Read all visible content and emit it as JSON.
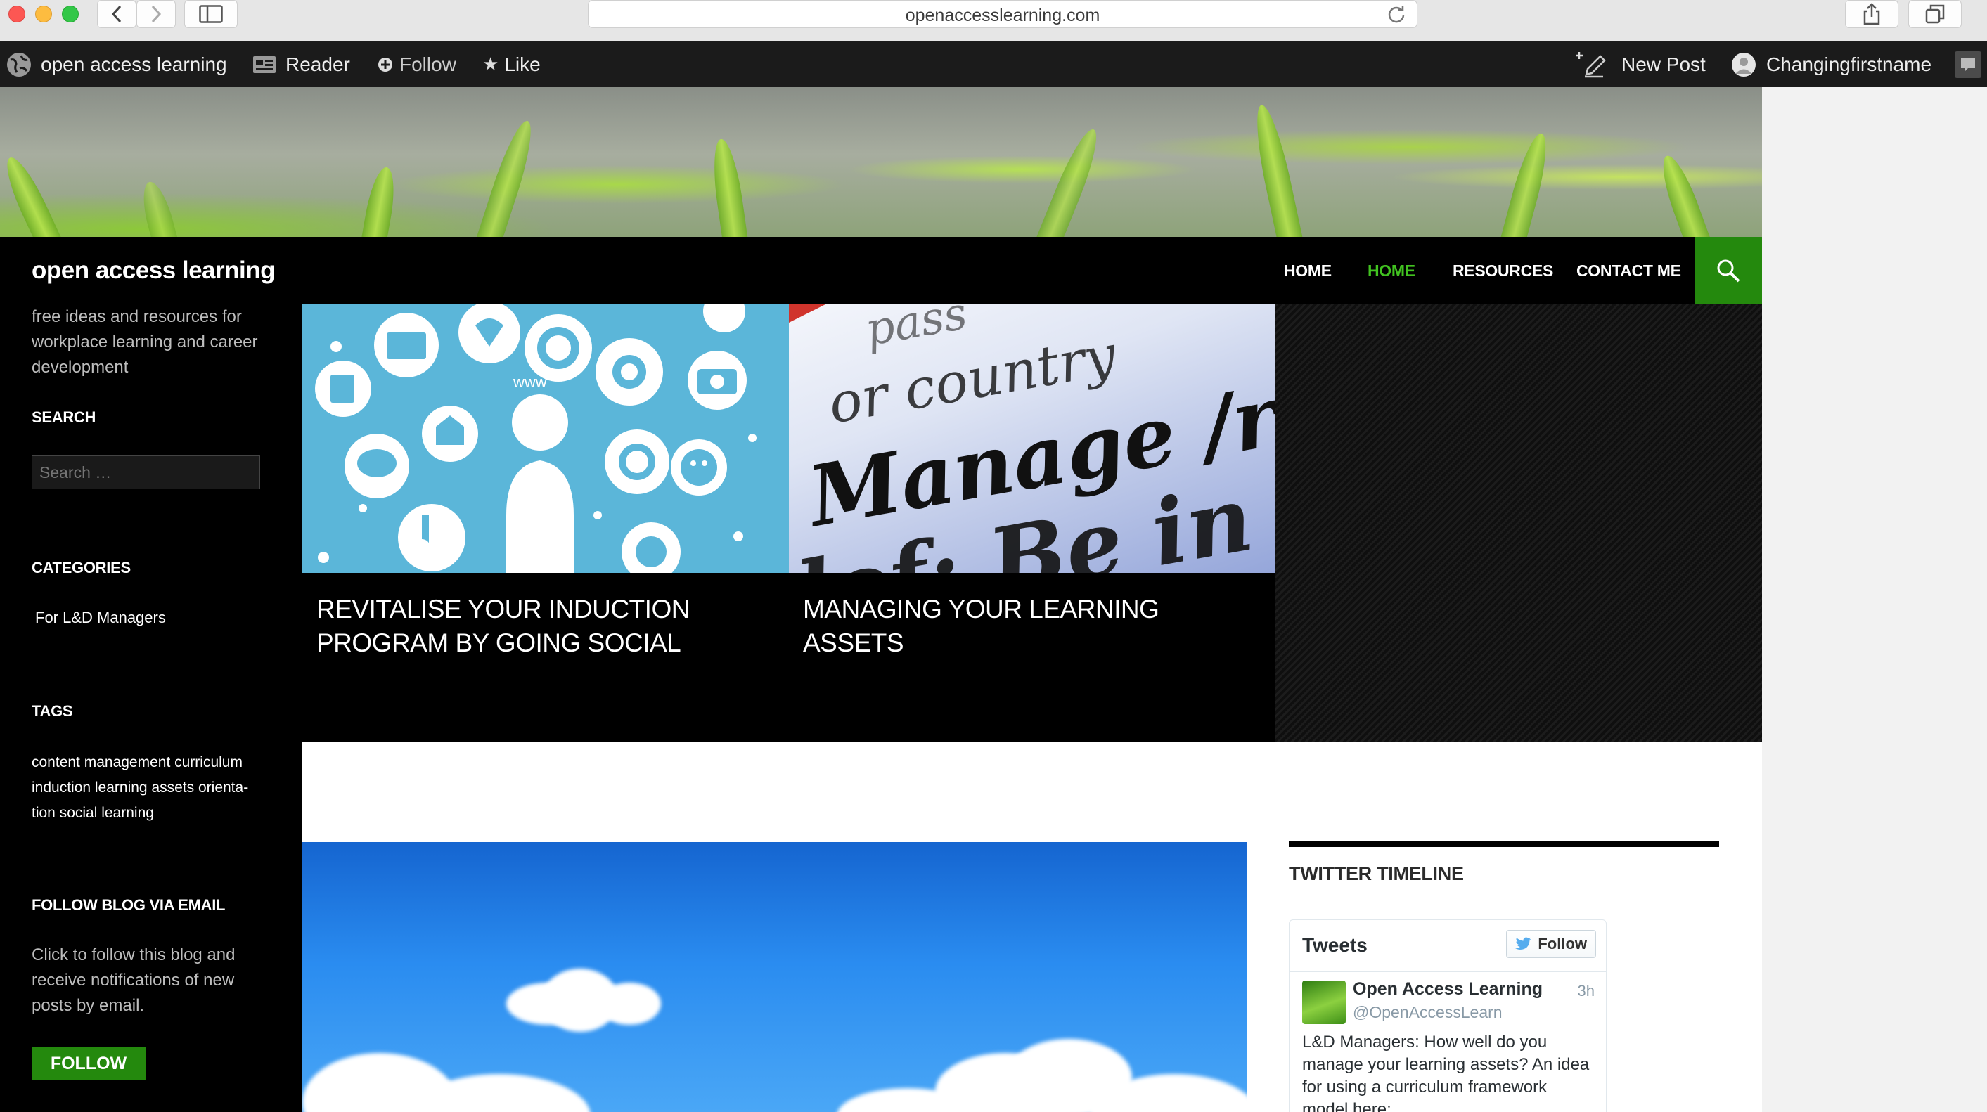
{
  "browser": {
    "url": "openaccesslearning.com"
  },
  "admin_bar": {
    "site_name": "open access learning",
    "reader": "Reader",
    "follow": "Follow",
    "like": "Like",
    "new_post": "New Post",
    "user_name": "Changingfirstname"
  },
  "site": {
    "title": "open access learning",
    "tagline": "free ideas and resources for workplace learning and career development"
  },
  "nav": {
    "items": [
      {
        "label": "HOME",
        "current": false
      },
      {
        "label": "HOME",
        "current": true
      },
      {
        "label": "RESOURCES",
        "current": false
      },
      {
        "label": "CONTACT ME",
        "current": false
      }
    ],
    "current_color": "#41c220"
  },
  "sidebar": {
    "search_heading": "SEARCH",
    "search_placeholder": "Search …",
    "categories_heading": "CATEGORIES",
    "categories": [
      "For L&D Managers"
    ],
    "tags_heading": "TAGS",
    "tags_lines": [
      "content management curriculum",
      "induction learning assets orienta-",
      "tion social learning"
    ],
    "follow_heading": "FOLLOW BLOG VIA EMAIL",
    "follow_text": "Click to follow this blog and receive notifications of new posts by email.",
    "follow_button": "FOLLOW"
  },
  "featured": [
    {
      "title": "REVITALISE YOUR INDUCTION PROGRAM BY GOING SOCIAL",
      "image": "social-media-icons-illustration"
    },
    {
      "title": "MANAGING YOUR LEARNING ASSETS",
      "image": "dictionary-manage-closeup"
    }
  ],
  "featured_image_text": {
    "line1": "pass",
    "line2": "or country",
    "line3": "Manage /r",
    "line4": "lef: Be in",
    "www": "www"
  },
  "twitter": {
    "heading": "TWITTER TIMELINE",
    "tweets_label": "Tweets",
    "follow_label": "Follow",
    "account_name": "Open Access Learning",
    "handle": "@OpenAccessLearn",
    "time": "3h",
    "tweet_text": "L&D Managers: How well do you manage your learning assets? An idea for using a curriculum framework model here:"
  },
  "colors": {
    "accent_green": "#24890d",
    "header_bg": "#000000",
    "twitter_blue": "#55acee"
  }
}
